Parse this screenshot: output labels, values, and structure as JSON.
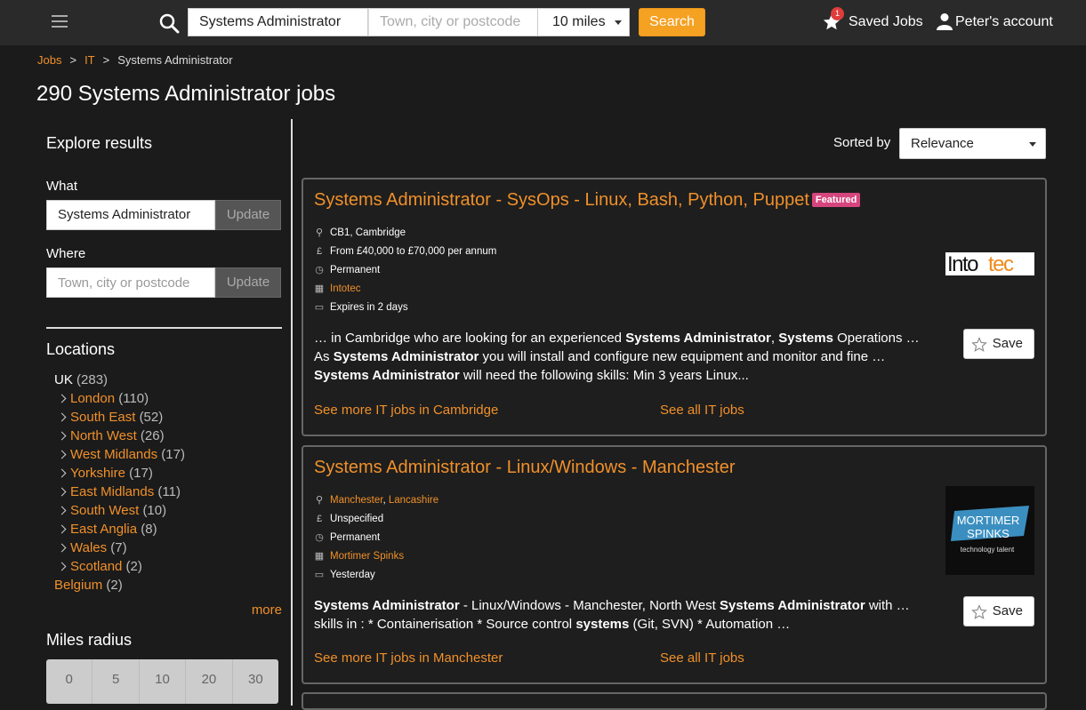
{
  "header": {
    "search_what_value": "Systems Administrator",
    "search_where_placeholder": "Town, city or postcode",
    "radius_value": "10 miles",
    "search_button": "Search",
    "saved_jobs_label": "Saved Jobs",
    "saved_jobs_count": "1",
    "account_label": "Peter's account"
  },
  "breadcrumb": {
    "items": [
      "Jobs",
      "IT",
      "Systems Administrator"
    ],
    "separator": ">"
  },
  "page_title": "290 Systems Administrator jobs",
  "sidebar": {
    "explore_title": "Explore results",
    "what_label": "What",
    "what_value": "Systems Administrator",
    "where_label": "Where",
    "where_placeholder": "Town, city or postcode",
    "update_label": "Update",
    "locations_title": "Locations",
    "root": {
      "name": "UK",
      "count": "(283)"
    },
    "regions": [
      {
        "name": "London",
        "count": "(110)"
      },
      {
        "name": "South East",
        "count": "(52)"
      },
      {
        "name": "North West",
        "count": "(26)"
      },
      {
        "name": "West Midlands",
        "count": "(17)"
      },
      {
        "name": "Yorkshire",
        "count": "(17)"
      },
      {
        "name": "East Midlands",
        "count": "(11)"
      },
      {
        "name": "South West",
        "count": "(10)"
      },
      {
        "name": "East Anglia",
        "count": "(8)"
      },
      {
        "name": "Wales",
        "count": "(7)"
      },
      {
        "name": "Scotland",
        "count": "(2)"
      }
    ],
    "other": {
      "name": "Belgium",
      "count": "(2)"
    },
    "more_label": "more",
    "radius_title": "Miles radius",
    "radius_options": [
      "0",
      "5",
      "10",
      "20",
      "30"
    ]
  },
  "results": {
    "sorted_label": "Sorted by",
    "sort_value": "Relevance",
    "jobs": [
      {
        "title": "Systems Administrator - SysOps - Linux, Bash, Python, Puppet",
        "featured": "Featured",
        "location": "CB1, Cambridge",
        "salary": "From £40,000 to £70,000 per annum",
        "type": "Permanent",
        "company": "Intotec",
        "expires": "Expires in 2 days",
        "logo_text": "Intotec",
        "save": "Save",
        "more_link": "See more IT jobs in Cambridge",
        "all_link": "See all IT jobs"
      },
      {
        "title": "Systems Administrator - Linux/Windows - Manchester",
        "location_a": "Manchester",
        "location_b": "Lancashire",
        "salary": "Unspecified",
        "type": "Permanent",
        "company": "Mortimer Spinks",
        "expires": "Yesterday",
        "logo_line1": "MORTIMER",
        "logo_line2": "SPINKS",
        "logo_tagline": "technology talent",
        "save": "Save",
        "more_link": "See more IT jobs in Manchester",
        "all_link": "See all IT jobs"
      }
    ]
  },
  "colors": {
    "accent": "#f0902a",
    "search_button": "#f5a122",
    "featured": "#d6457d",
    "background": "#1b1b1b",
    "topbar": "#2a2a2a"
  }
}
